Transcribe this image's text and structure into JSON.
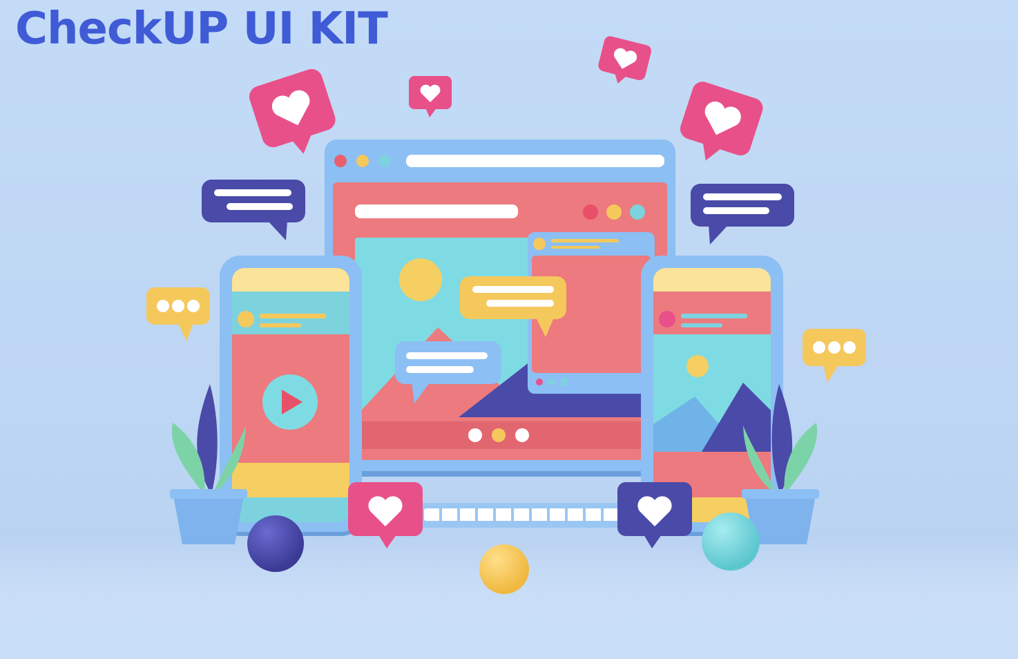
{
  "header": {
    "title": "CheckUP UI KIT"
  },
  "colors": {
    "background": "#c3dbf6",
    "title": "#3f5bd6",
    "pink": "#e86e8b",
    "magenta": "#e8508a",
    "teal": "#7dd3dd",
    "yellow": "#f5c85c",
    "purple": "#4a4aa8",
    "frame": "#7eb3ee"
  },
  "icons": {
    "heart": "heart-icon",
    "play": "play-icon",
    "chat": "chat-bubble-icon",
    "dots": "typing-dots-icon"
  }
}
